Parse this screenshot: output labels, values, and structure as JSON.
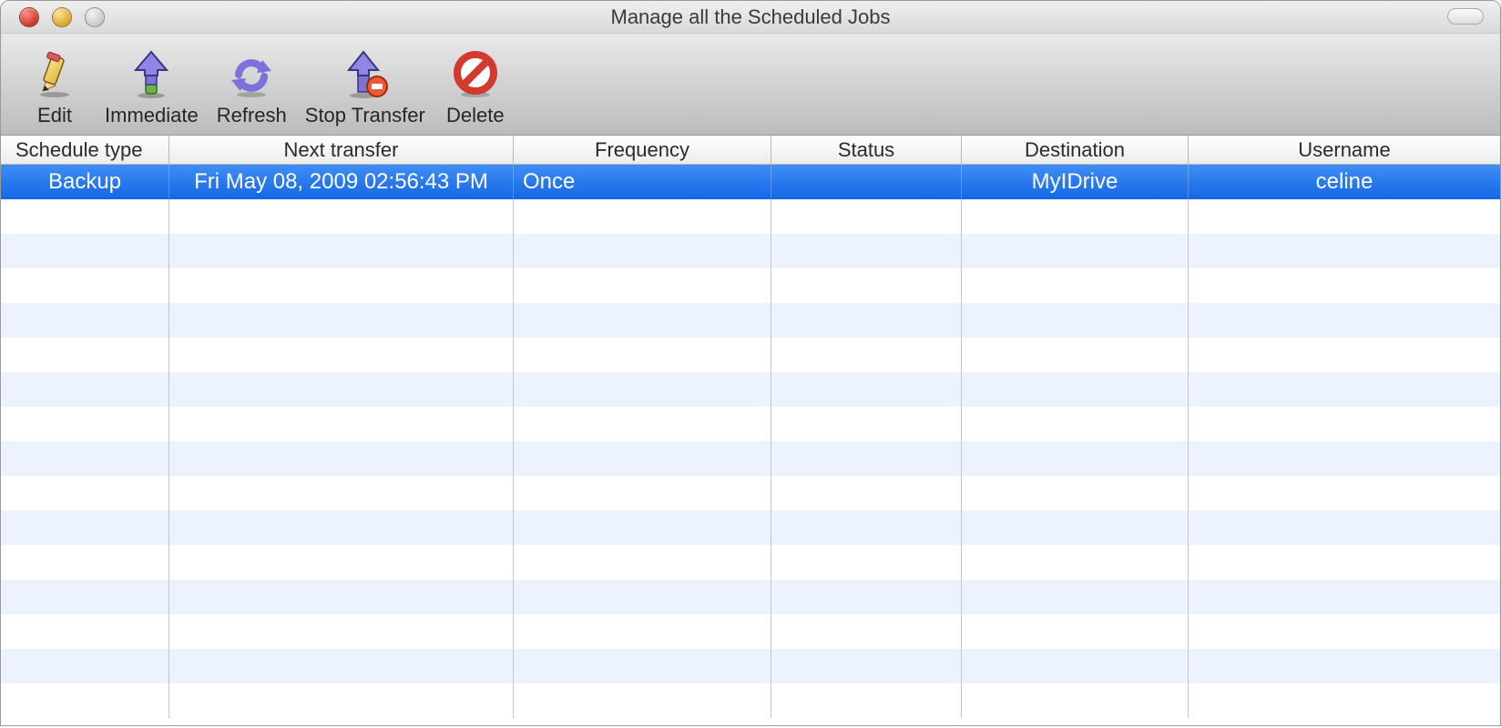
{
  "window": {
    "title": "Manage all the Scheduled Jobs"
  },
  "toolbar": {
    "edit": "Edit",
    "immediate": "Immediate",
    "refresh": "Refresh",
    "stop_transfer": "Stop Transfer",
    "delete": "Delete"
  },
  "columns": {
    "schedule_type": "Schedule type",
    "next_transfer": "Next transfer",
    "frequency": "Frequency",
    "status": "Status",
    "destination": "Destination",
    "username": "Username"
  },
  "rows": [
    {
      "schedule_type": "Backup",
      "next_transfer": "Fri May 08, 2009 02:56:43 PM",
      "frequency": "Once",
      "status": "",
      "destination": "MyIDrive",
      "username": "celine",
      "selected": true
    }
  ],
  "empty_row_count": 15
}
